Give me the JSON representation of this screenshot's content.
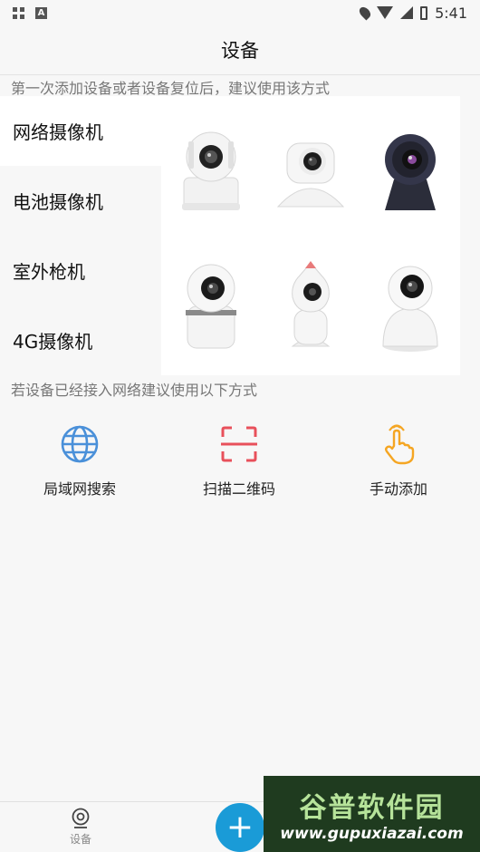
{
  "status_bar": {
    "time": "5:41"
  },
  "title": "设备",
  "hints": {
    "new_device": "第一次添加设备或者设备复位后，建议使用该方式",
    "networked": "若设备已经接入网络建议使用以下方式"
  },
  "categories": [
    {
      "label": "网络摄像机",
      "selected": true
    },
    {
      "label": "电池摄像机",
      "selected": false
    },
    {
      "label": "室外枪机",
      "selected": false
    },
    {
      "label": "4G摄像机",
      "selected": false
    }
  ],
  "actions": [
    {
      "label": "局域网搜索",
      "icon": "globe-icon",
      "color": "#4a90d9"
    },
    {
      "label": "扫描二维码",
      "icon": "scan-icon",
      "color": "#e8505b"
    },
    {
      "label": "手动添加",
      "icon": "hand-pointer-icon",
      "color": "#f5a623"
    }
  ],
  "bottom_nav": {
    "device_label": "设备",
    "fab_symbol": "+"
  },
  "watermark": {
    "line1": "谷普软件园",
    "line2": "www.gupuxiazai.com"
  },
  "colors": {
    "accent": "#1a9bd7"
  }
}
